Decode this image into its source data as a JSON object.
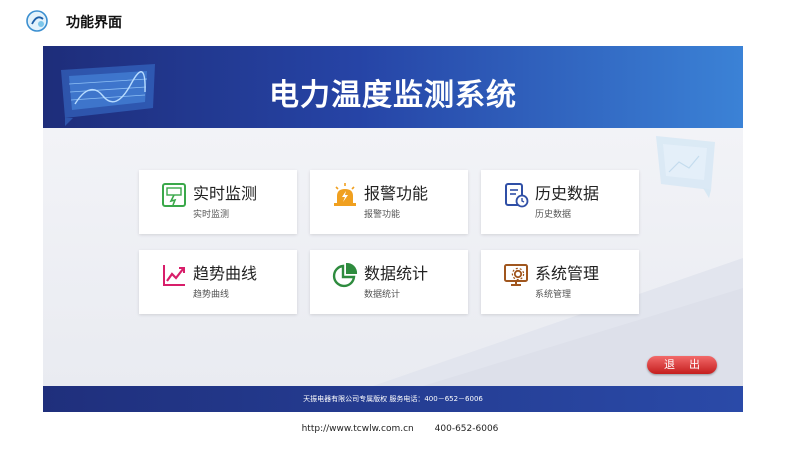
{
  "page": {
    "title": "功能界面"
  },
  "app": {
    "title": "电力温度监测系统"
  },
  "menu": [
    {
      "title": "实时监测",
      "subtitle": "实时监测",
      "icon": "monitor-icon",
      "color": "#3aa84a"
    },
    {
      "title": "报警功能",
      "subtitle": "报警功能",
      "icon": "alarm-icon",
      "color": "#f0a020"
    },
    {
      "title": "历史数据",
      "subtitle": "历史数据",
      "icon": "history-document-icon",
      "color": "#2f4fa6"
    },
    {
      "title": "趋势曲线",
      "subtitle": "趋势曲线",
      "icon": "trend-chart-icon",
      "color": "#d81e6a"
    },
    {
      "title": "数据统计",
      "subtitle": "数据统计",
      "icon": "pie-chart-icon",
      "color": "#2e8b3e"
    },
    {
      "title": "系统管理",
      "subtitle": "系统管理",
      "icon": "system-settings-icon",
      "color": "#a0561e"
    }
  ],
  "exit": {
    "label": "退出"
  },
  "footer": {
    "text": "天振电器有限公司专属版权   服务电话：400－652－6006"
  },
  "bottom": {
    "url": "http://www.tcwlw.com.cn",
    "phone": "400-652-6006"
  },
  "colors": {
    "header_dark": "#1e2d7a",
    "header_light": "#3b82d6",
    "exit": "#d42a2a"
  }
}
